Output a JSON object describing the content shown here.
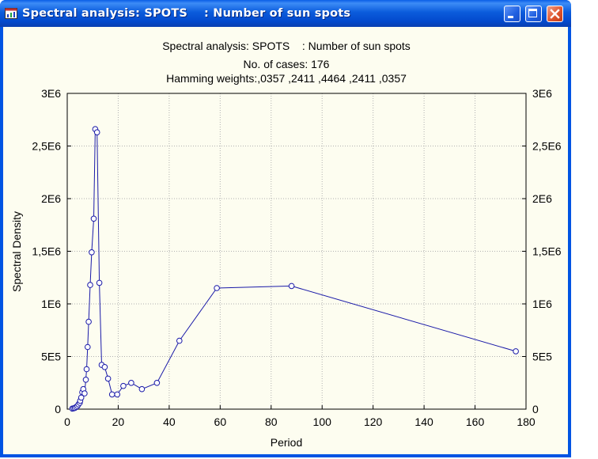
{
  "window": {
    "title": "Spectral analysis: SPOTS    : Number of sun spots",
    "icon": "chart-app-icon",
    "controls": [
      "minimize-icon",
      "maximize-icon",
      "close-icon"
    ]
  },
  "colors": {
    "titlebar": "#0054e3",
    "background": "#fdfdf0",
    "series": "#1a1aa8",
    "grid": "#b0b0b0"
  },
  "chart_data": {
    "type": "line",
    "title": "Spectral analysis: SPOTS    : Number of sun spots",
    "subtitle_lines": [
      "No. of cases: 176",
      "Hamming weights:,0357 ,2411 ,4464 ,2411 ,0357"
    ],
    "xlabel": "Period",
    "ylabel": "Spectral Density",
    "xlim": [
      0,
      180
    ],
    "ylim": [
      0,
      3000000
    ],
    "x_ticks": [
      0,
      20,
      40,
      60,
      80,
      100,
      120,
      140,
      160,
      180
    ],
    "x_tick_labels": [
      "0",
      "20",
      "40",
      "60",
      "80",
      "100",
      "120",
      "140",
      "160",
      "180"
    ],
    "y_ticks": [
      0,
      500000,
      1000000,
      1500000,
      2000000,
      2500000,
      3000000
    ],
    "y_tick_labels": [
      "0",
      "5E5",
      "1E6",
      "1,5E6",
      "2E6",
      "2,5E6",
      "3E6"
    ],
    "grid": true,
    "markers": "open-circle",
    "series": [
      {
        "points": [
          [
            2.0,
            5000
          ],
          [
            2.5,
            8000
          ],
          [
            3.0,
            12000
          ],
          [
            3.5,
            20000
          ],
          [
            4.0,
            30000
          ],
          [
            4.4,
            45000
          ],
          [
            4.9,
            60000
          ],
          [
            5.1,
            80000
          ],
          [
            5.5,
            110000
          ],
          [
            5.9,
            160000
          ],
          [
            6.3,
            190000
          ],
          [
            6.8,
            150000
          ],
          [
            7.3,
            280000
          ],
          [
            7.6,
            380000
          ],
          [
            8.0,
            590000
          ],
          [
            8.4,
            830000
          ],
          [
            9.0,
            1180000
          ],
          [
            9.6,
            1490000
          ],
          [
            10.4,
            1810000
          ],
          [
            11.0,
            2660000
          ],
          [
            11.7,
            2630000
          ],
          [
            12.6,
            1200000
          ],
          [
            13.5,
            420000
          ],
          [
            14.7,
            400000
          ],
          [
            16.0,
            290000
          ],
          [
            17.6,
            140000
          ],
          [
            19.6,
            140000
          ],
          [
            22.0,
            220000
          ],
          [
            25.1,
            250000
          ],
          [
            29.3,
            190000
          ],
          [
            35.2,
            250000
          ],
          [
            44.0,
            650000
          ],
          [
            58.7,
            1150000
          ],
          [
            88.0,
            1170000
          ],
          [
            176.0,
            550000
          ]
        ]
      }
    ]
  }
}
